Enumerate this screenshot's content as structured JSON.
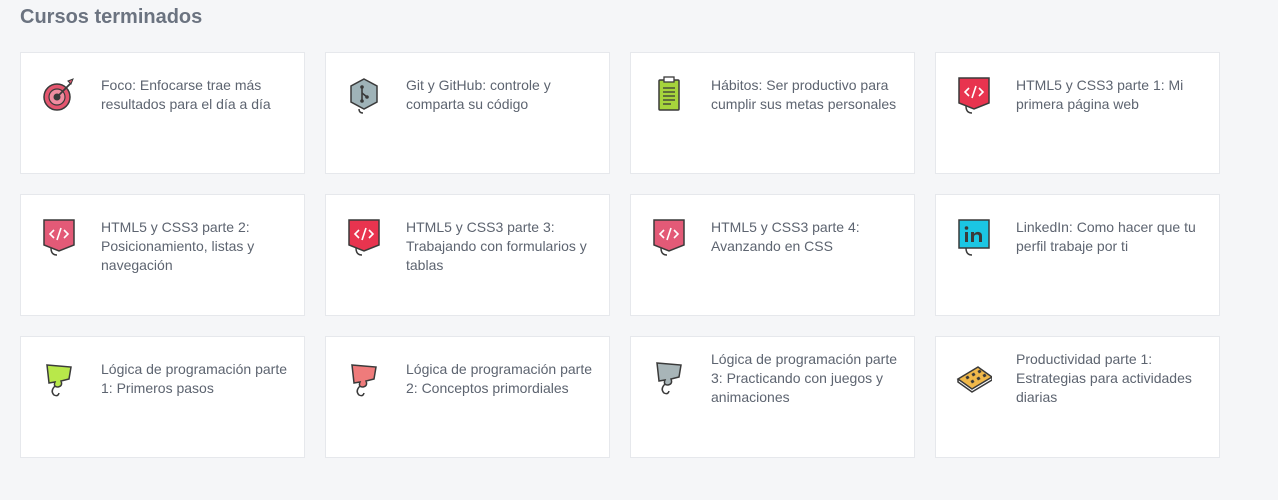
{
  "section": {
    "title": "Cursos terminados"
  },
  "courses": [
    {
      "title": "Foco: Enfocarse trae más resultados para el día a día",
      "icon": "target-icon"
    },
    {
      "title": "Git y GitHub: controle y comparta su código",
      "icon": "git-icon"
    },
    {
      "title": "Hábitos: Ser productivo para cumplir sus metas personales",
      "icon": "clipboard-icon"
    },
    {
      "title": "HTML5 y CSS3 parte 1: Mi primera página web",
      "icon": "html-code-icon"
    },
    {
      "title": "HTML5 y CSS3 parte 2: Posicionamiento, listas y navegación",
      "icon": "html-code-icon"
    },
    {
      "title": "HTML5 y CSS3 parte 3: Trabajando con formularios y tablas",
      "icon": "html-code-icon"
    },
    {
      "title": "HTML5 y CSS3 parte 4: Avanzando en CSS",
      "icon": "html-code-icon"
    },
    {
      "title": "LinkedIn: Como hacer que tu perfil trabaje por ti",
      "icon": "linkedin-icon"
    },
    {
      "title": "Lógica de programación parte 1: Primeros pasos",
      "icon": "puzzle-icon"
    },
    {
      "title": "Lógica de programación parte 2: Conceptos primordiales",
      "icon": "puzzle-icon"
    },
    {
      "title": "Lógica de programación parte 3: Practicando con juegos y animaciones",
      "icon": "puzzle-icon"
    },
    {
      "title": "Productividad parte 1: Estrategias para actividades diarias",
      "icon": "planner-board-icon"
    }
  ],
  "colors": {
    "target": "#e4566f",
    "git": "#9fb3b8",
    "clipboard": "#a6d43c",
    "html1": "#e8344f",
    "html2": "#e35a77",
    "html3": "#e8344f",
    "html4": "#e35a77",
    "linkedin": "#1bc6e3",
    "puzzle1": "#b8e84a",
    "puzzle2": "#ef7b7b",
    "puzzle3": "#a8b5b8",
    "planner": "#f0b84a"
  }
}
